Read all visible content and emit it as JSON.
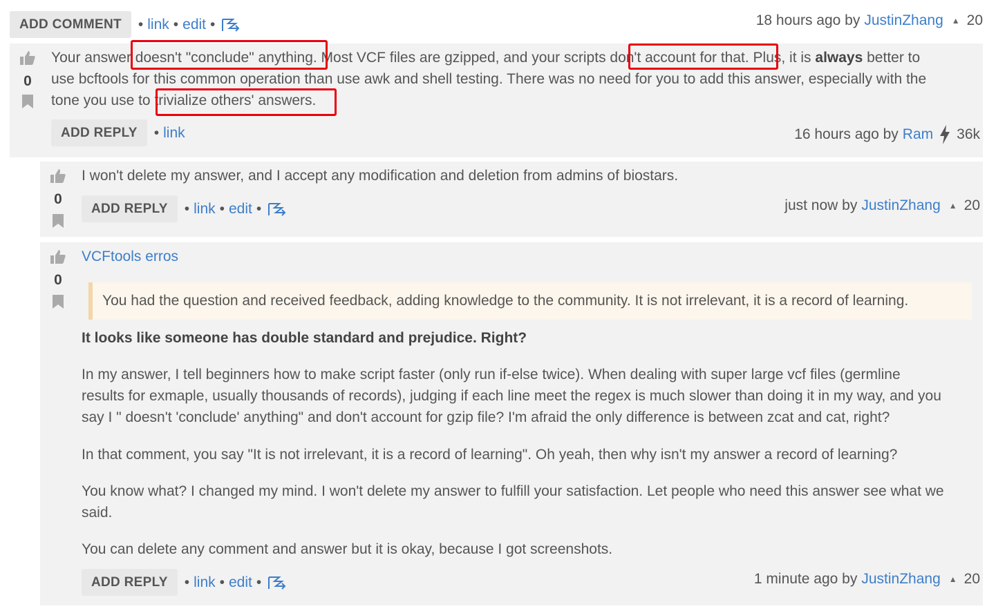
{
  "top_bar": {
    "add_comment": "ADD COMMENT",
    "link": "link",
    "edit": "edit",
    "time": "18 hours ago by",
    "author": "JustinZhang",
    "rep": "20"
  },
  "comment1": {
    "votes": "0",
    "line1_a": "Your answer doesn't \"conclude\" anything. Most VCF files are gzipped, and your scripts don't account for that. Plus, it is ",
    "line1_bold": "always",
    "line1_b": " better to",
    "line2": "use bcftools for this common operation than use awk and shell testing. There was no need for you to add this answer, especially with the",
    "line3": "tone you use to trivialize others' answers.",
    "add_reply": "ADD REPLY",
    "link": "link",
    "time": "16 hours ago by",
    "author": "Ram",
    "rep": "36k"
  },
  "reply1": {
    "votes": "0",
    "text": "I won't delete my answer, and I accept any modification and deletion from admins of biostars.",
    "add_reply": "ADD REPLY",
    "link": "link",
    "edit": "edit",
    "time": "just now by",
    "author": "JustinZhang",
    "rep": "20"
  },
  "reply2": {
    "votes": "0",
    "title_link": "VCFtools erros",
    "quote": "You had the question and received feedback, adding knowledge to the community. It is not irrelevant, it is a record of learning.",
    "bold_line": "It looks like someone has double standard and prejudice. Right?",
    "para1_l1": "In my answer, I tell beginners how to make script faster (only run if-else twice). When dealing with super large vcf files (germline",
    "para1_l2": "results for exmaple, usually thousands of records), judging if each line meet the regex is much slower than doing it in my way, and you",
    "para1_l3": "say I \" doesn't 'conclude' anything\" and don't account for gzip file? I'm afraid the only difference is between zcat and cat, right?",
    "para2": "In that comment, you say \"It is not irrelevant, it is a record of learning\". Oh yeah, then why isn't my answer a record of learning?",
    "para3_l1": "You know what? I changed my mind. I won't delete my answer to fulfill your satisfaction. Let people who need this answer see what we",
    "para3_l2": "said.",
    "para4": "You can delete any comment and answer but it is okay, because I got screenshots.",
    "add_reply": "ADD REPLY",
    "link": "link",
    "edit": "edit",
    "time": "1 minute ago by",
    "author": "JustinZhang",
    "rep": "20"
  },
  "colors": {
    "link": "#3d7ec9",
    "highlight_box": "#e8000b",
    "panel": "#f2f2f2",
    "quote_bg": "#fdf6ec",
    "quote_border": "#f2d6a9"
  },
  "icons": [
    "thumbs-up-icon",
    "bookmark-icon",
    "moderate-icon",
    "caret-up-icon",
    "lightning-icon"
  ]
}
